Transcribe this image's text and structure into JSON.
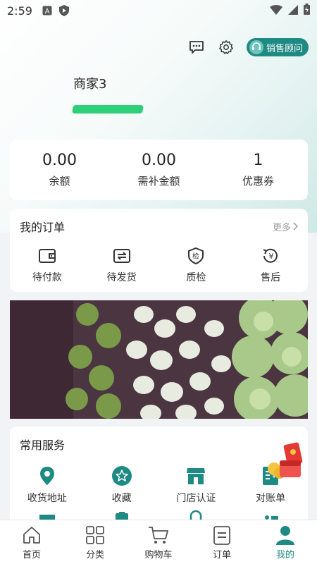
{
  "status_bar": {
    "time": "2:59"
  },
  "header": {
    "merchant_name": "商家3",
    "advisor_label": "销售顾问"
  },
  "balance": [
    {
      "value": "0.00",
      "label": "余额"
    },
    {
      "value": "0.00",
      "label": "需补金额"
    },
    {
      "value": "1",
      "label": "优惠券"
    }
  ],
  "orders": {
    "title": "我的订单",
    "more": "更多",
    "items": [
      {
        "label": "待付款",
        "icon": "wallet-icon"
      },
      {
        "label": "待发货",
        "icon": "shipment-icon"
      },
      {
        "label": "质检",
        "icon": "inspection-shield-icon"
      },
      {
        "label": "售后",
        "icon": "refund-yen-icon"
      }
    ]
  },
  "services": {
    "title": "常用服务",
    "items": [
      {
        "label": "收货地址",
        "icon": "location-pin-icon"
      },
      {
        "label": "收藏",
        "icon": "star-icon"
      },
      {
        "label": "门店认证",
        "icon": "store-icon"
      },
      {
        "label": "对账单",
        "icon": "statement-icon"
      }
    ]
  },
  "tabs": [
    {
      "label": "首页",
      "icon": "home-icon"
    },
    {
      "label": "分类",
      "icon": "category-grid-icon"
    },
    {
      "label": "购物车",
      "icon": "cart-icon"
    },
    {
      "label": "订单",
      "icon": "order-list-icon"
    },
    {
      "label": "我的",
      "icon": "profile-icon",
      "active": true
    }
  ],
  "colors": {
    "accent": "#1e8a83",
    "service_icon": "#1e8a83",
    "background": "#f2f3f5"
  }
}
